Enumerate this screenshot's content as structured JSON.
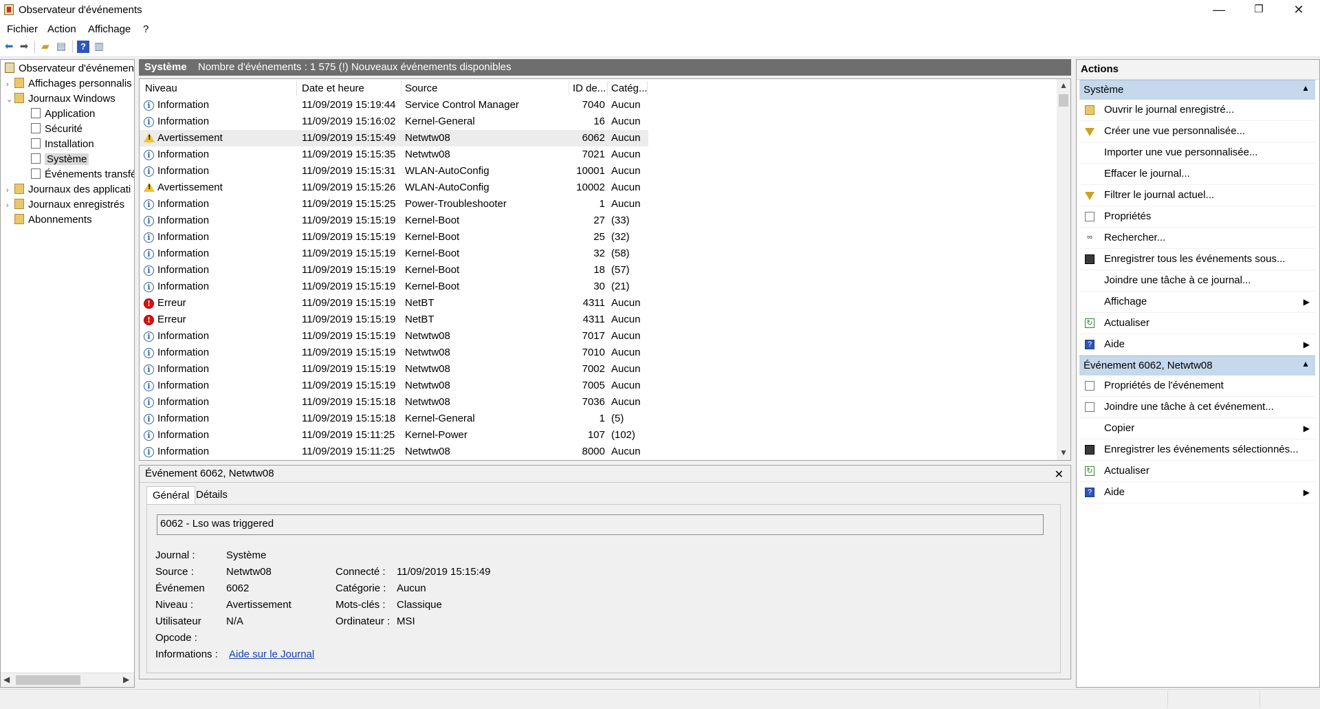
{
  "window": {
    "title": "Observateur d'événements",
    "controls": {
      "minimize": "—",
      "maximize": "❐",
      "close": "✕"
    }
  },
  "menu": [
    "Fichier",
    "Action",
    "Affichage",
    "?"
  ],
  "toolbar_icons": [
    "back-arrow-icon",
    "forward-arrow-icon",
    "up-folder-icon",
    "console-tree-icon",
    "help-icon",
    "show-hide-action-pane-icon"
  ],
  "tree": {
    "root": "Observateur d'événement",
    "items": [
      {
        "label": "Affichages personnalis",
        "expander": "›",
        "depth": 1
      },
      {
        "label": "Journaux Windows",
        "expander": "⌄",
        "depth": 1
      },
      {
        "label": "Application",
        "depth": 2
      },
      {
        "label": "Sécurité",
        "depth": 2
      },
      {
        "label": "Installation",
        "depth": 2
      },
      {
        "label": "Système",
        "depth": 2,
        "selected": true
      },
      {
        "label": "Événements transfé",
        "depth": 2
      },
      {
        "label": "Journaux des applicati",
        "expander": "›",
        "depth": 1
      },
      {
        "label": "Journaux enregistrés",
        "expander": "›",
        "depth": 1
      },
      {
        "label": "Abonnements",
        "depth": 1
      }
    ]
  },
  "center": {
    "log_name": "Système",
    "summary": "Nombre d'événements : 1 575 (!) Nouveaux événements disponibles",
    "columns": [
      "Niveau",
      "Date et heure",
      "Source",
      "ID de...",
      "Catég..."
    ],
    "rows": [
      {
        "level": "Information",
        "type": "info",
        "date": "11/09/2019 15:19:44",
        "source": "Service Control Manager",
        "id": "7040",
        "cat": "Aucun"
      },
      {
        "level": "Information",
        "type": "info",
        "date": "11/09/2019 15:16:02",
        "source": "Kernel-General",
        "id": "16",
        "cat": "Aucun"
      },
      {
        "level": "Avertissement",
        "type": "warn",
        "date": "11/09/2019 15:15:49",
        "source": "Netwtw08",
        "id": "6062",
        "cat": "Aucun",
        "selected": true
      },
      {
        "level": "Information",
        "type": "info",
        "date": "11/09/2019 15:15:35",
        "source": "Netwtw08",
        "id": "7021",
        "cat": "Aucun"
      },
      {
        "level": "Information",
        "type": "info",
        "date": "11/09/2019 15:15:31",
        "source": "WLAN-AutoConfig",
        "id": "10001",
        "cat": "Aucun"
      },
      {
        "level": "Avertissement",
        "type": "warn",
        "date": "11/09/2019 15:15:26",
        "source": "WLAN-AutoConfig",
        "id": "10002",
        "cat": "Aucun"
      },
      {
        "level": "Information",
        "type": "info",
        "date": "11/09/2019 15:15:25",
        "source": "Power-Troubleshooter",
        "id": "1",
        "cat": "Aucun"
      },
      {
        "level": "Information",
        "type": "info",
        "date": "11/09/2019 15:15:19",
        "source": "Kernel-Boot",
        "id": "27",
        "cat": "(33)"
      },
      {
        "level": "Information",
        "type": "info",
        "date": "11/09/2019 15:15:19",
        "source": "Kernel-Boot",
        "id": "25",
        "cat": "(32)"
      },
      {
        "level": "Information",
        "type": "info",
        "date": "11/09/2019 15:15:19",
        "source": "Kernel-Boot",
        "id": "32",
        "cat": "(58)"
      },
      {
        "level": "Information",
        "type": "info",
        "date": "11/09/2019 15:15:19",
        "source": "Kernel-Boot",
        "id": "18",
        "cat": "(57)"
      },
      {
        "level": "Information",
        "type": "info",
        "date": "11/09/2019 15:15:19",
        "source": "Kernel-Boot",
        "id": "30",
        "cat": "(21)"
      },
      {
        "level": "Erreur",
        "type": "err",
        "date": "11/09/2019 15:15:19",
        "source": "NetBT",
        "id": "4311",
        "cat": "Aucun"
      },
      {
        "level": "Erreur",
        "type": "err",
        "date": "11/09/2019 15:15:19",
        "source": "NetBT",
        "id": "4311",
        "cat": "Aucun"
      },
      {
        "level": "Information",
        "type": "info",
        "date": "11/09/2019 15:15:19",
        "source": "Netwtw08",
        "id": "7017",
        "cat": "Aucun"
      },
      {
        "level": "Information",
        "type": "info",
        "date": "11/09/2019 15:15:19",
        "source": "Netwtw08",
        "id": "7010",
        "cat": "Aucun"
      },
      {
        "level": "Information",
        "type": "info",
        "date": "11/09/2019 15:15:19",
        "source": "Netwtw08",
        "id": "7002",
        "cat": "Aucun"
      },
      {
        "level": "Information",
        "type": "info",
        "date": "11/09/2019 15:15:19",
        "source": "Netwtw08",
        "id": "7005",
        "cat": "Aucun"
      },
      {
        "level": "Information",
        "type": "info",
        "date": "11/09/2019 15:15:18",
        "source": "Netwtw08",
        "id": "7036",
        "cat": "Aucun"
      },
      {
        "level": "Information",
        "type": "info",
        "date": "11/09/2019 15:15:18",
        "source": "Kernel-General",
        "id": "1",
        "cat": "(5)"
      },
      {
        "level": "Information",
        "type": "info",
        "date": "11/09/2019 15:11:25",
        "source": "Kernel-Power",
        "id": "107",
        "cat": "(102)"
      },
      {
        "level": "Information",
        "type": "info",
        "date": "11/09/2019 15:11:25",
        "source": "Netwtw08",
        "id": "8000",
        "cat": "Aucun"
      }
    ]
  },
  "detail": {
    "header": "Événement 6062, Netwtw08",
    "close": "✕",
    "tabs": [
      "Général",
      "Détails"
    ],
    "message": "6062 - Lso was triggered",
    "fields_left": [
      {
        "label": "Journal :",
        "value": "Système"
      },
      {
        "label": "Source :",
        "value": "Netwtw08"
      },
      {
        "label": "Événemen",
        "value": "6062"
      },
      {
        "label": "Niveau :",
        "value": "Avertissement"
      },
      {
        "label": "Utilisateur",
        "value": "N/A"
      },
      {
        "label": "Opcode :",
        "value": ""
      },
      {
        "label": "Informations :",
        "value": "Aide sur le Journal",
        "link": true
      }
    ],
    "fields_right": [
      {
        "label": "Connecté :",
        "value": "11/09/2019 15:15:49"
      },
      {
        "label": "Catégorie :",
        "value": "Aucun"
      },
      {
        "label": "Mots-clés :",
        "value": "Classique"
      },
      {
        "label": "Ordinateur :",
        "value": "MSI"
      }
    ]
  },
  "actions": {
    "title": "Actions",
    "section1": {
      "title": "Système",
      "items": [
        {
          "label": "Ouvrir le journal enregistré...",
          "icon": "open-folder-icon"
        },
        {
          "label": "Créer une vue personnalisée...",
          "icon": "filter-icon"
        },
        {
          "label": "Importer une vue personnalisée...",
          "icon": ""
        },
        {
          "label": "Effacer le journal...",
          "icon": ""
        },
        {
          "label": "Filtrer le journal actuel...",
          "icon": "filter-icon"
        },
        {
          "label": "Propriétés",
          "icon": "properties-icon"
        },
        {
          "label": "Rechercher...",
          "icon": "binoculars-icon"
        },
        {
          "label": "Enregistrer tous les événements sous...",
          "icon": "save-icon"
        },
        {
          "label": "Joindre une tâche à ce journal...",
          "icon": ""
        },
        {
          "label": "Affichage",
          "icon": "",
          "submenu": true
        },
        {
          "label": "Actualiser",
          "icon": "refresh-icon"
        },
        {
          "label": "Aide",
          "icon": "help-icon",
          "submenu": true
        }
      ]
    },
    "section2": {
      "title": "Événement 6062, Netwtw08",
      "items": [
        {
          "label": "Propriétés de l'événement",
          "icon": "properties-icon"
        },
        {
          "label": "Joindre une tâche à cet événement...",
          "icon": "task-icon"
        },
        {
          "label": "Copier",
          "icon": "",
          "submenu": true
        },
        {
          "label": "Enregistrer les événements sélectionnés...",
          "icon": "save-icon"
        },
        {
          "label": "Actualiser",
          "icon": "refresh-icon"
        },
        {
          "label": "Aide",
          "icon": "help-icon",
          "submenu": true
        }
      ]
    }
  },
  "colors": {
    "header_bar": "#6e6e6e",
    "section_header": "#c5d8ec",
    "link": "#1a3fb0",
    "error": "#dd1111",
    "warning": "#f2c230",
    "info": "#2c5fa8"
  }
}
